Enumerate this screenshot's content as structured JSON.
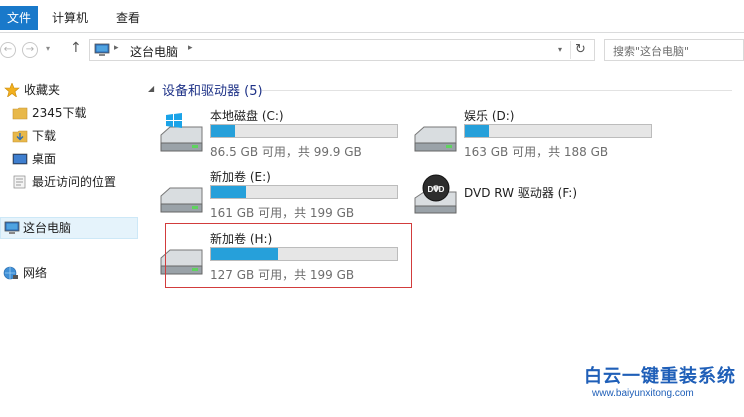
{
  "ribbon": {
    "tabs": [
      "文件",
      "计算机",
      "查看"
    ]
  },
  "address_bar": {
    "path": [
      "这台电脑"
    ],
    "separator": "▸",
    "refresh_glyph": "↻"
  },
  "search": {
    "placeholder": "搜索\"这台电脑\""
  },
  "nav": {
    "back": "←",
    "forward": "→",
    "up": "↑",
    "dropdown": "▾"
  },
  "navigation_pane": {
    "favorites_label": "收藏夹",
    "favorites": [
      "2345下载",
      "下载",
      "桌面",
      "最近访问的位置"
    ],
    "this_pc_label": "这台电脑",
    "network_label": "网络"
  },
  "group": {
    "title": "设备和驱动器 (5)",
    "chevron": "◢"
  },
  "drives": [
    {
      "name": "本地磁盘 (C:)",
      "size": "86.5 GB 可用，共 99.9 GB",
      "used_fraction": 0.13,
      "type": "os"
    },
    {
      "name": "娱乐 (D:)",
      "size": "163 GB 可用，共 188 GB",
      "used_fraction": 0.13,
      "type": "disk"
    },
    {
      "name": "新加卷 (E:)",
      "size": "161 GB 可用，共 199 GB",
      "used_fraction": 0.19,
      "type": "disk"
    },
    {
      "name": "DVD RW 驱动器 (F:)",
      "size": "",
      "type": "dvd"
    },
    {
      "name": "新加卷 (H:)",
      "size": "127 GB 可用，共 199 GB",
      "used_fraction": 0.36,
      "type": "disk"
    }
  ],
  "watermark": {
    "title": "白云一键重装系统",
    "url": "www.baiyunxitong.com"
  },
  "colors": {
    "accent": "#1979ca",
    "bar_fill": "#26a0da",
    "group_title": "#1e3287",
    "highlight": "#d23c3c"
  }
}
